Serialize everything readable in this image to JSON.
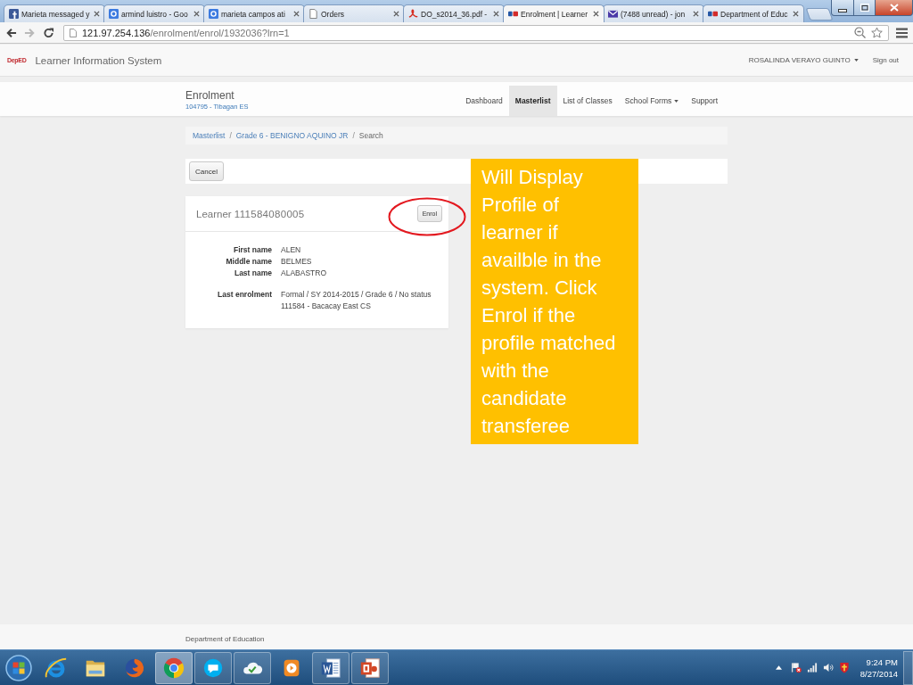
{
  "browser": {
    "tabs": [
      {
        "title": "Marieta messaged y",
        "kind": "facebook",
        "selected": false
      },
      {
        "title": "armind luistro - Goo",
        "kind": "google",
        "selected": false
      },
      {
        "title": "marieta campos ati",
        "kind": "google",
        "selected": false
      },
      {
        "title": "Orders",
        "kind": "document",
        "selected": false
      },
      {
        "title": "DO_s2014_36.pdf -",
        "kind": "pdf",
        "selected": false
      },
      {
        "title": "Enrolment | Learner",
        "kind": "deped",
        "selected": true
      },
      {
        "title": "(7488 unread) - jon",
        "kind": "mail",
        "selected": false
      },
      {
        "title": "Department of Educ",
        "kind": "deped",
        "selected": false
      }
    ],
    "forward_disabled": true,
    "address": {
      "host": "121.97.254.136",
      "path": "/enrolment/enrol/1932036?lrn=1"
    }
  },
  "app_bar": {
    "logo": "DepED",
    "title": "Learner Information System",
    "user_menu": {
      "label": "ROSALINDA VERAYO GUINTO",
      "dropdown": true
    },
    "sign_out": "Sign out"
  },
  "page_header": {
    "title": "Enrolment",
    "subtitle": "104795 - Tibagan ES",
    "nav": [
      {
        "label": "Dashboard",
        "selected": false,
        "dropdown": false
      },
      {
        "label": "Masterlist",
        "selected": true,
        "dropdown": false
      },
      {
        "label": "List of Classes",
        "selected": false,
        "dropdown": false
      },
      {
        "label": "School Forms",
        "selected": false,
        "dropdown": true
      },
      {
        "label": "Support",
        "selected": false,
        "dropdown": false
      }
    ]
  },
  "breadcrumb": [
    {
      "label": "Masterlist",
      "kind": "link"
    },
    {
      "label": "/",
      "kind": "separator"
    },
    {
      "label": "Grade 6 - BENIGNO AQUINO JR",
      "kind": "link"
    },
    {
      "label": "/",
      "kind": "separator"
    },
    {
      "label": "Search",
      "kind": "current"
    }
  ],
  "actions": {
    "cancel_button": "Cancel"
  },
  "learner_card": {
    "title": "Learner",
    "lrn": "111584080005",
    "enrol_button": {
      "label": "Enrol",
      "highlighted": true
    },
    "field_groups": [
      [
        {
          "label": "First name",
          "lines": [
            "ALEN"
          ]
        },
        {
          "label": "Middle name",
          "lines": [
            "BELMES"
          ]
        },
        {
          "label": "Last name",
          "lines": [
            "ALABASTRO"
          ]
        }
      ],
      [
        {
          "label": "Last enrolment",
          "lines": [
            "Formal / SY 2014-2015 / Grade 6 / No status",
            "111584 - Bacacay East CS"
          ]
        }
      ]
    ]
  },
  "callout": {
    "text": "Will Display Profile of learner if availble in the system. Click Enrol if the profile matched with the candidate transferee"
  },
  "footer": {
    "text": "Department of Education"
  },
  "taskbar": {
    "apps": [
      {
        "kind": "ie",
        "running": false,
        "selected": false
      },
      {
        "kind": "explorer",
        "running": false,
        "selected": false
      },
      {
        "kind": "firefox",
        "running": false,
        "selected": false
      },
      {
        "kind": "chrome",
        "running": true,
        "selected": true
      },
      {
        "kind": "skype",
        "running": true,
        "selected": false
      },
      {
        "kind": "cloud",
        "running": true,
        "selected": false
      },
      {
        "kind": "media",
        "running": false,
        "selected": false
      },
      {
        "kind": "word",
        "running": true,
        "selected": false
      },
      {
        "kind": "powerpoint",
        "running": true,
        "selected": false
      }
    ],
    "time": "9:24 PM",
    "date": "8/27/2014"
  }
}
